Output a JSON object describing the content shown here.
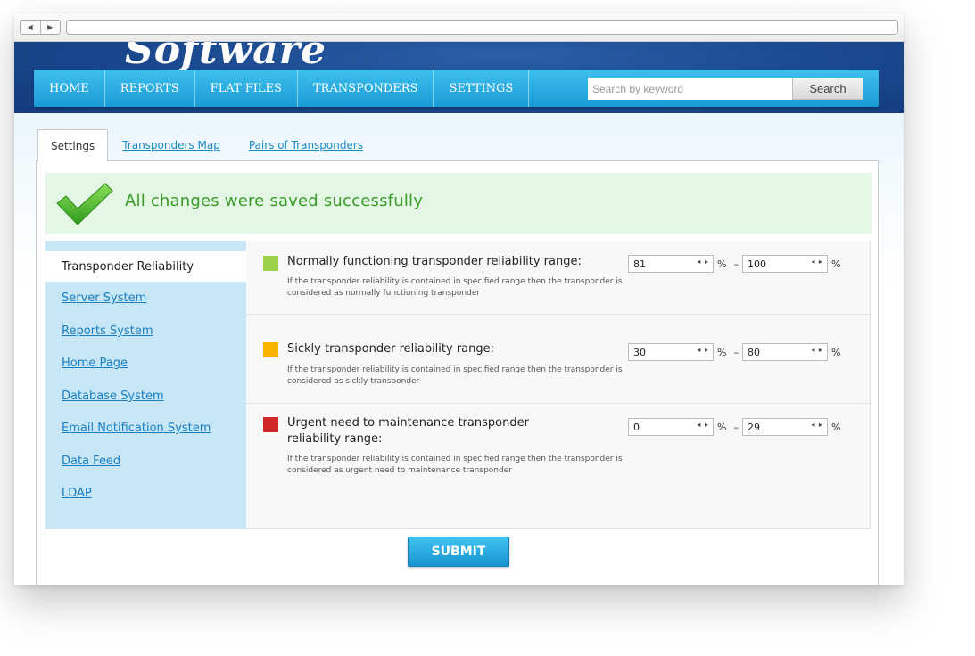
{
  "header": {
    "logo_text": "Software"
  },
  "nav": {
    "items": [
      "HOME",
      "REPORTS",
      "FLAT FILES",
      "TRANSPONDERS",
      "SETTINGS"
    ]
  },
  "search": {
    "placeholder": "Search by keyword",
    "button_label": "Search"
  },
  "tabs": [
    "Settings",
    "Transponders Map",
    "Pairs of Transponders"
  ],
  "message": {
    "text": "All changes were saved successfully"
  },
  "sidebar": {
    "active": "Transponder Reliability",
    "items": [
      "Server System",
      "Reports System",
      "Home Page",
      "Database System",
      "Email Notification System",
      "Data Feed",
      "LDAP"
    ]
  },
  "ranges": [
    {
      "title": "Normally functioning transponder reliability range:",
      "description": "If the transponder reliability is contained in specified range then the transponder is considered as normally functioning transponder",
      "color": "#9ed04a",
      "min": "81",
      "max": "100"
    },
    {
      "title": "Sickly transponder reliability range:",
      "description": "If the transponder reliability is contained in specified range then the transponder is considered as sickly transponder",
      "color": "#f6b400",
      "min": "30",
      "max": "80"
    },
    {
      "title": "Urgent need to maintenance transponder reliability range:",
      "description": "If the transponder reliability is contained in specified range then the transponder is considered as urgent need to maintenance transponder",
      "color": "#d3262b",
      "min": "0",
      "max": "29"
    }
  ],
  "units": {
    "percent": "%",
    "dash": "–",
    "arrows": "◂ ▸"
  },
  "submit": {
    "label": "SUBMIT"
  },
  "colors": {
    "accent": "#1a9bd6",
    "success": "#3a9c28",
    "sidebar_bg": "#c7e6f6"
  }
}
